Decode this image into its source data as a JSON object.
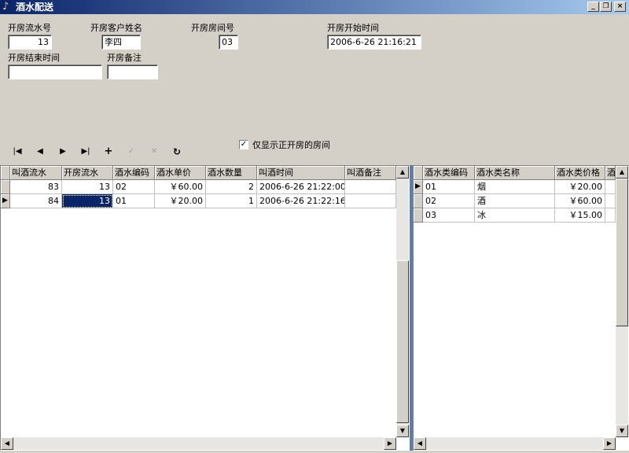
{
  "window": {
    "title": "酒水配送",
    "controls": [
      "_",
      "❐",
      "×"
    ]
  },
  "form": {
    "open_serial_label": "开房流水号",
    "open_serial_value": "13",
    "customer_name_label": "开房客户姓名",
    "customer_name_value": "李四",
    "room_no_label": "开房房间号",
    "room_no_value": "03",
    "start_time_label": "开房开始时间",
    "start_time_value": "2006-6-26 21:16:21",
    "end_time_label": "开房结束时间",
    "end_time_value": "",
    "remark_label": "开房备注",
    "remark_value": ""
  },
  "navigator": {
    "first": "|◀",
    "prior": "◀",
    "next": "▶",
    "last": "▶|",
    "insert": "+",
    "post": "✓",
    "cancel": "✕",
    "refresh": "↻"
  },
  "filter": {
    "checked": true,
    "check_mark": "✓",
    "label": "仅显示正开房的房间"
  },
  "orders_grid": {
    "columns": [
      "叫酒流水",
      "开房流水",
      "酒水编码",
      "酒水单价",
      "酒水数量",
      "叫酒时间",
      "叫酒备注"
    ],
    "rows": [
      {
        "indicator": "",
        "values": [
          "83",
          "13",
          "02",
          "￥60.00",
          "2",
          "2006-6-26 21:22:00",
          ""
        ]
      },
      {
        "indicator": "▶",
        "values": [
          "84",
          "13",
          "01",
          "￥20.00",
          "1",
          "2006-6-26 21:22:16",
          ""
        ]
      }
    ]
  },
  "drinks_grid": {
    "columns": [
      "酒水类编码",
      "酒水类名称",
      "酒水类价格",
      "酒"
    ],
    "rows": [
      {
        "indicator": "▶",
        "values": [
          "01",
          "烟",
          "￥20.00",
          ""
        ]
      },
      {
        "indicator": "",
        "values": [
          "02",
          "酒",
          "￥60.00",
          ""
        ]
      },
      {
        "indicator": "",
        "values": [
          "03",
          "冰",
          "￥15.00",
          ""
        ]
      }
    ]
  },
  "scroll": {
    "up": "▲",
    "down": "▼",
    "left": "◀",
    "right": "▶"
  }
}
